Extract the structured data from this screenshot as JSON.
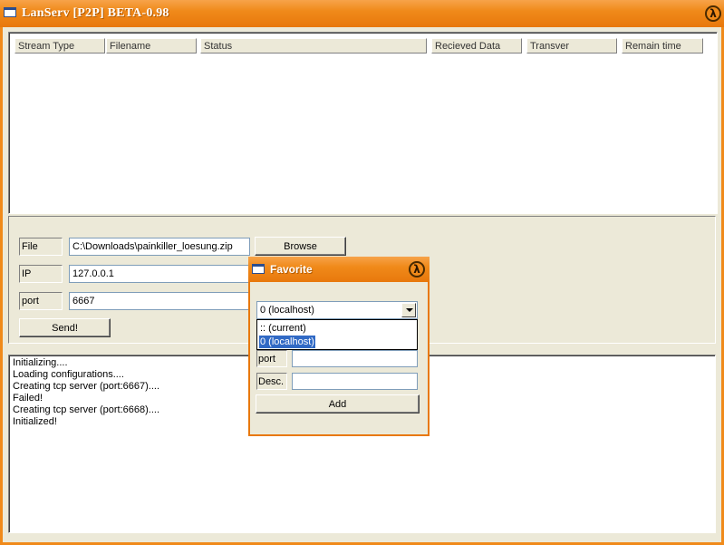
{
  "window": {
    "title": "LanServ [P2P] BETA-0.98"
  },
  "transfer_list": {
    "columns": [
      "Stream Type",
      "Filename",
      "Status",
      "Recieved Data",
      "Transver",
      "Remain time"
    ]
  },
  "controls": {
    "file_label": "File",
    "file_value": "C:\\Downloads\\painkiller_loesung.zip",
    "browse_label": "Browse",
    "ip_label": "IP",
    "ip_value": "127.0.0.1",
    "port_label": "port",
    "port_value": "6667",
    "send_label": "Send!"
  },
  "log": {
    "lines": [
      "Initializing....",
      "Loading configurations....",
      "Creating tcp server (port:6667)....",
      "Failed!",
      "Creating tcp server (port:6668)....",
      "Initialized!"
    ]
  },
  "favorite_dialog": {
    "title": "Favorite",
    "combo_value": "0 (localhost)",
    "dropdown_options": [
      ":: (current)",
      "0 (localhost)"
    ],
    "selected_option": 1,
    "port_label": "port",
    "desc_label": "Desc.",
    "add_label": "Add"
  },
  "colors": {
    "titlebar": "#f08a1a",
    "selection": "#316ac5",
    "face": "#ece9d8"
  },
  "icons": {
    "title_icon": "window-icon",
    "close_icon": "half-life-lambda-icon"
  }
}
